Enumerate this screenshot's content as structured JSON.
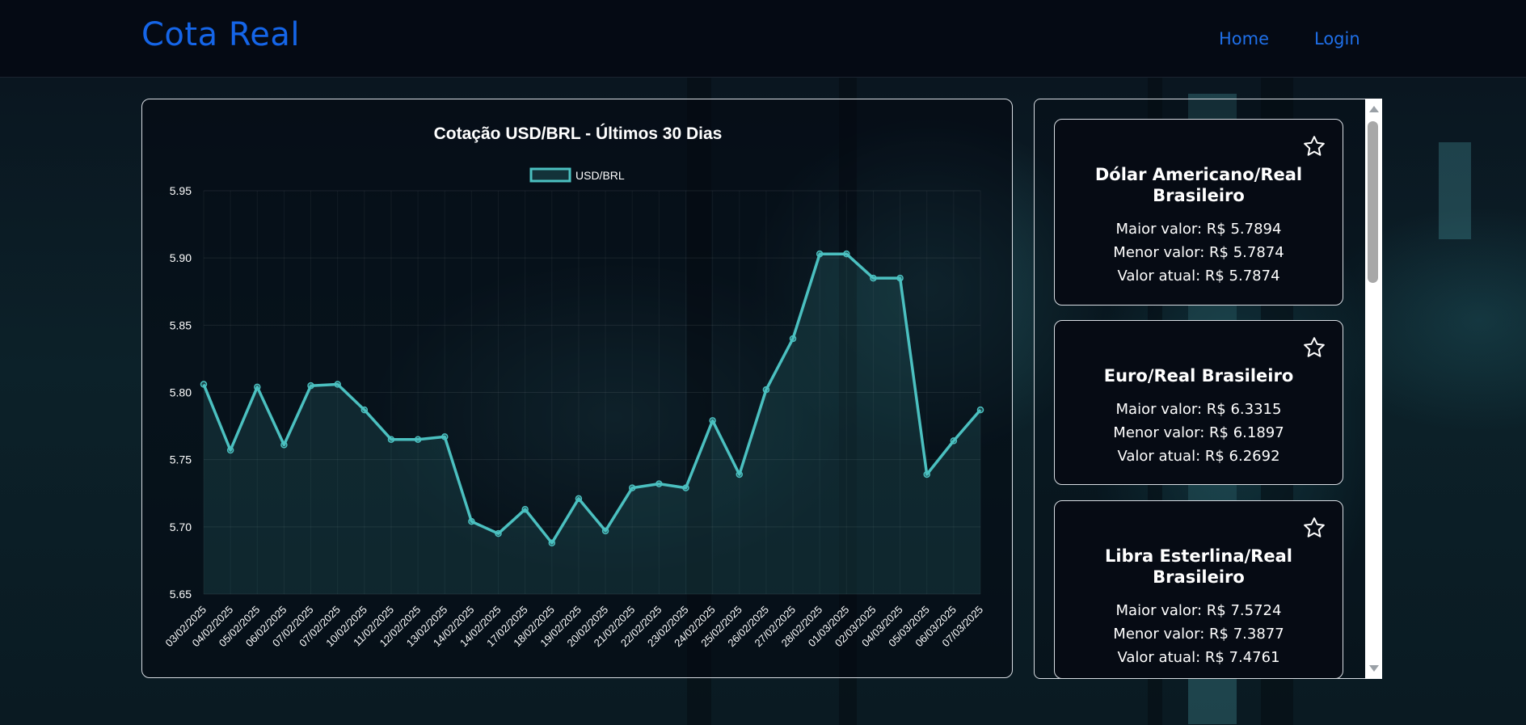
{
  "header": {
    "brand": "Cota Real",
    "nav": {
      "home": "Home",
      "login": "Login"
    }
  },
  "colors": {
    "brand": "#1565e8",
    "line": "#4bc0c0",
    "background": "#050a14"
  },
  "chart_data": {
    "type": "line",
    "title": "Cotação USD/BRL - Últimos 30 Dias",
    "legend_position": "top-center",
    "grid": true,
    "area_fill": true,
    "ylim": [
      5.65,
      5.95
    ],
    "yticks": [
      "5.95",
      "5.90",
      "5.85",
      "5.80",
      "5.75",
      "5.70",
      "5.65"
    ],
    "categories": [
      "03/02/2025",
      "04/02/2025",
      "05/02/2025",
      "06/02/2025",
      "07/02/2025",
      "07/02/2025",
      "10/02/2025",
      "11/02/2025",
      "12/02/2025",
      "13/02/2025",
      "14/02/2025",
      "14/02/2025",
      "17/02/2025",
      "18/02/2025",
      "19/02/2025",
      "20/02/2025",
      "21/02/2025",
      "22/02/2025",
      "23/02/2025",
      "24/02/2025",
      "25/02/2025",
      "26/02/2025",
      "27/02/2025",
      "28/02/2025",
      "01/03/2025",
      "02/03/2025",
      "04/03/2025",
      "05/03/2025",
      "06/03/2025",
      "07/03/2025"
    ],
    "series": [
      {
        "name": "USD/BRL",
        "values": [
          5.806,
          5.757,
          5.804,
          5.761,
          5.805,
          5.806,
          5.787,
          5.765,
          5.765,
          5.767,
          5.704,
          5.695,
          5.713,
          5.688,
          5.721,
          5.697,
          5.729,
          5.732,
          5.729,
          5.779,
          5.739,
          5.802,
          5.84,
          5.903,
          5.903,
          5.885,
          5.885,
          5.739,
          5.764,
          5.787
        ]
      }
    ]
  },
  "cards": [
    {
      "title": "Dólar Americano/Real Brasileiro",
      "max": "Maior valor: R$ 5.7894",
      "min": "Menor valor: R$ 5.7874",
      "current": "Valor atual: R$ 5.7874",
      "icon": "star-outline-icon"
    },
    {
      "title": "Euro/Real Brasileiro",
      "max": "Maior valor: R$ 6.3315",
      "min": "Menor valor: R$ 6.1897",
      "current": "Valor atual: R$ 6.2692",
      "icon": "star-outline-icon"
    },
    {
      "title": "Libra Esterlina/Real Brasileiro",
      "max": "Maior valor: R$ 7.5724",
      "min": "Menor valor: R$ 7.3877",
      "current": "Valor atual: R$ 7.4761",
      "icon": "star-outline-icon"
    }
  ]
}
